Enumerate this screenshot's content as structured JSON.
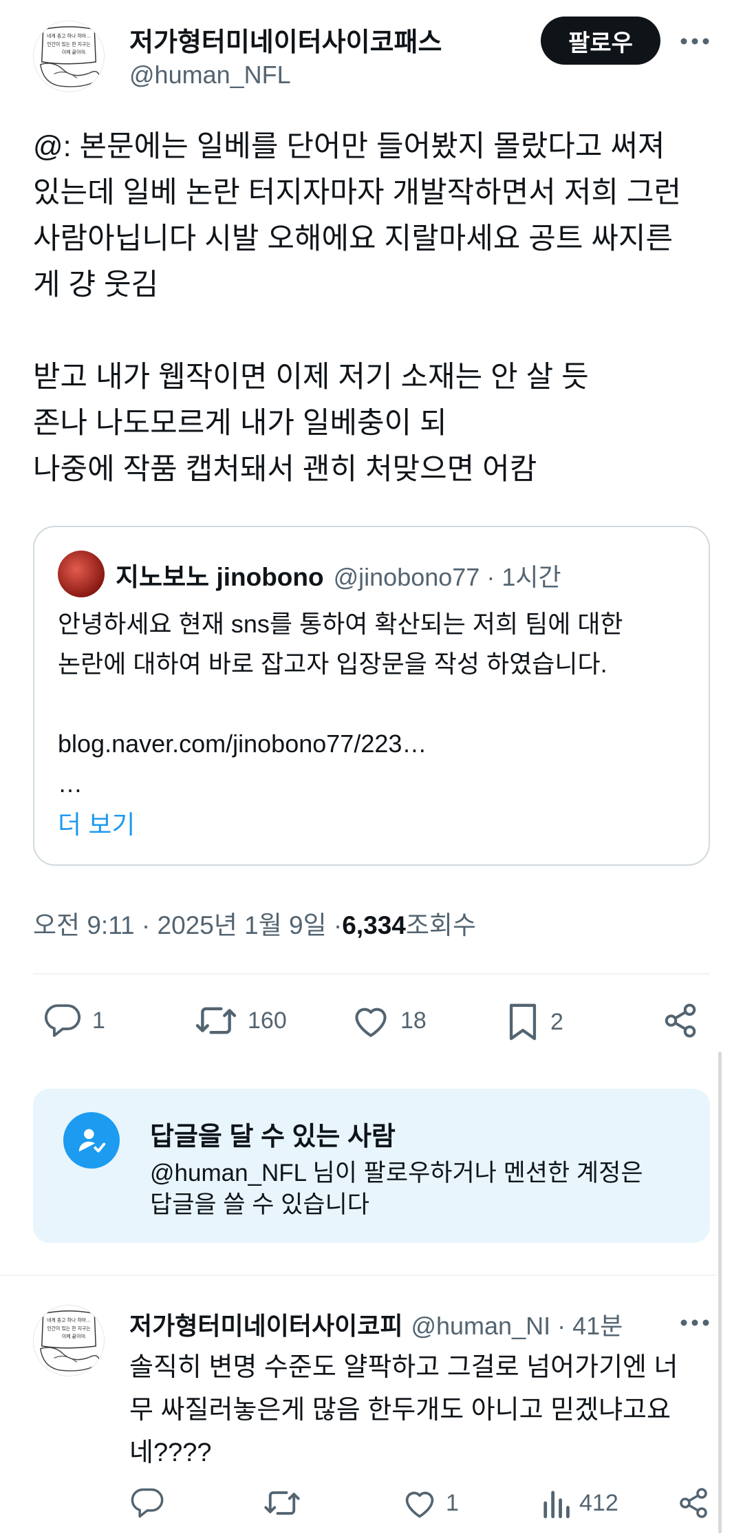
{
  "tweet": {
    "author": {
      "display_name": "저가형터미네이터사이코패스",
      "handle": "@human_NFL",
      "avatar_text": [
        "네게 총고 하나 하마…",
        "인간이 있는 한 지구는",
        "이제 끝이야."
      ]
    },
    "follow_label": "팔로우",
    "body": "@: 본문에는 일베를 단어만 들어봤지 몰랐다고 써져\n있는데 일베 논란 터지자마자 개발작하면서 저희 그런\n사람아닙니다 시발 오해에요 지랄마세요 공트 싸지른\n게 걍 웃김\n\n받고 내가 웹작이면 이제 저기 소재는 안 살 듯\n존나 나도모르게 내가 일베충이 되\n나중에 작품 캡처돼서 괜히 처맞으면 어캄",
    "quote": {
      "display_name": "지노보노 jinobono",
      "handle": "@jinobono77",
      "time": "· 1시간",
      "text": "안녕하세요 현재 sns를 통하여 확산되는 저희 팀에 대한\n논란에 대하여 바로 잡고자 입장문을 작성 하였습니다.\n\nblog.naver.com/jinobono77/223…\n…",
      "show_more": "더 보기"
    },
    "timestamp": "오전 9:11 · 2025년 1월 9일 · ",
    "views_count": "6,334",
    "views_label": " 조회수",
    "actions": {
      "replies": "1",
      "retweets": "160",
      "likes": "18",
      "bookmarks": "2"
    }
  },
  "reply_notice": {
    "title": "답글을 달 수 있는 사람",
    "description": "@human_NFL 님이 팔로우하거나 멘션한 계정은\n답글을 쓸 수 있습니다"
  },
  "reply": {
    "display_name": "저가형터미네이터사이코피",
    "handle": "@human_NI",
    "time": "· 41분",
    "text": "솔직히 변명 수준도 얄팍하고 그걸로 넘어가기엔 너\n무 싸질러놓은게 많음 한두개도 아니고 믿겠냐고요\n네????",
    "actions": {
      "replies": "",
      "retweets": "",
      "likes": "1",
      "views": "412"
    }
  },
  "colors": {
    "accent": "#1d9bf0",
    "text": "#0f1419",
    "muted": "#536471",
    "notice_bg": "#e8f5fd"
  }
}
